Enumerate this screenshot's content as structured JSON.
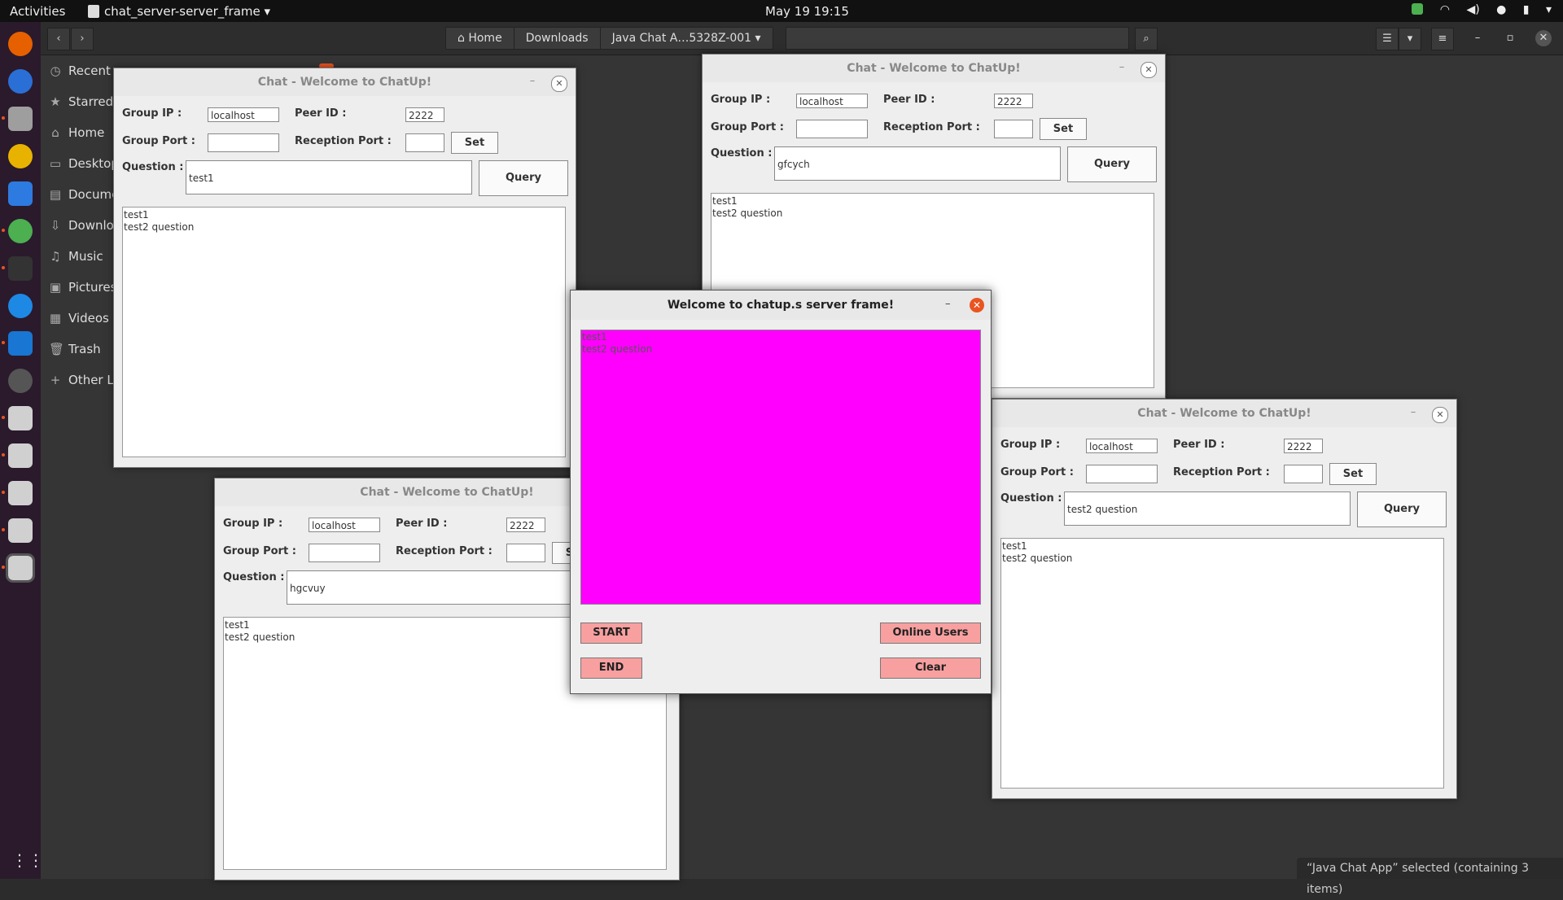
{
  "topbar": {
    "activities": "Activities",
    "app_menu": "chat_server-server_frame ▾",
    "clock": "May 19  19:15"
  },
  "file_manager": {
    "path": [
      "Home",
      "Downloads",
      "Java Chat A…5328Z-001"
    ],
    "path_dropdown": "▾",
    "sidebar": [
      {
        "icon": "clock-icon",
        "glyph": "◷",
        "label": "Recent"
      },
      {
        "icon": "star-icon",
        "glyph": "★",
        "label": "Starred"
      },
      {
        "icon": "home-icon",
        "glyph": "⌂",
        "label": "Home"
      },
      {
        "icon": "desktop-icon",
        "glyph": "▭",
        "label": "Desktop"
      },
      {
        "icon": "document-icon",
        "glyph": "▤",
        "label": "Documents"
      },
      {
        "icon": "download-icon",
        "glyph": "⇩",
        "label": "Downloads"
      },
      {
        "icon": "music-icon",
        "glyph": "♫",
        "label": "Music"
      },
      {
        "icon": "picture-icon",
        "glyph": "▣",
        "label": "Pictures"
      },
      {
        "icon": "video-icon",
        "glyph": "▦",
        "label": "Videos"
      },
      {
        "icon": "trash-icon",
        "glyph": "🗑",
        "label": "Trash"
      },
      {
        "icon": "plus-icon",
        "glyph": "+",
        "label": "Other Locations"
      }
    ],
    "status": "“Java Chat App” selected  (containing 3 items)"
  },
  "chat_labels": {
    "title": "Chat - Welcome to ChatUp!",
    "group_ip": "Group IP :",
    "peer_id": "Peer ID :",
    "group_port": "Group Port :",
    "reception_port": "Reception Port :",
    "question": "Question :",
    "set": "Set",
    "query": "Query",
    "minimize": "–",
    "close": "✕"
  },
  "chat_windows": [
    {
      "group_ip": "localhost",
      "peer_id": "2222",
      "group_port": "",
      "reception_port": "",
      "question": "test1",
      "messages": [
        "test1",
        "test2 question"
      ]
    },
    {
      "group_ip": "localhost",
      "peer_id": "2222",
      "group_port": "",
      "reception_port": "",
      "question": "gfcych",
      "messages": [
        "test1",
        "test2 question"
      ]
    },
    {
      "group_ip": "localhost",
      "peer_id": "2222",
      "group_port": "",
      "reception_port": "",
      "question": "hgcvuy",
      "messages": [
        "test1",
        "test2 question"
      ]
    },
    {
      "group_ip": "localhost",
      "peer_id": "2222",
      "group_port": "",
      "reception_port": "",
      "question": "test2 question",
      "messages": [
        "test1",
        "test2 question"
      ]
    }
  ],
  "server": {
    "title": "Welcome to chatup.s server frame!",
    "messages": [
      "test1",
      "test2 question"
    ],
    "start": "START",
    "end": "END",
    "online_users": "Online Users",
    "clear": "Clear",
    "minimize": "–",
    "close": "✕",
    "area_color": "#ff00ff",
    "button_color": "#f8a0a0"
  }
}
